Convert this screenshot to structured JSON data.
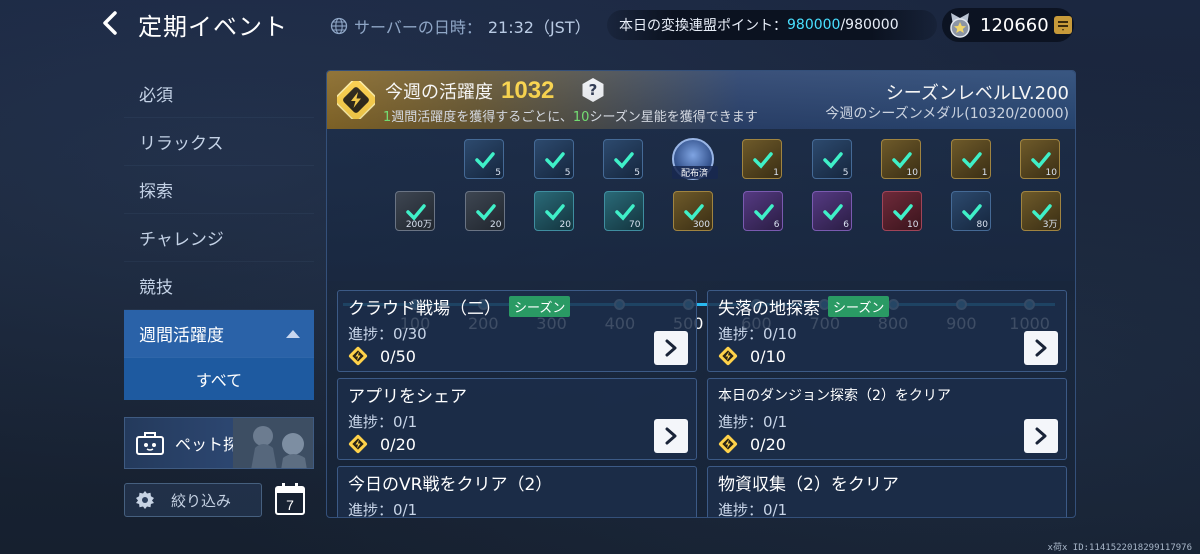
{
  "topbar": {
    "title": "定期イベント",
    "server_time_label": "サーバーの日時：",
    "server_time_value": "21:32（JST）",
    "points_label": "本日の変換連盟ポイント：",
    "points_current": "980000",
    "points_max": "/980000",
    "currency_amount": "120660"
  },
  "sidebar": {
    "items": [
      {
        "label": "必須"
      },
      {
        "label": "リラックス"
      },
      {
        "label": "探索"
      },
      {
        "label": "チャレンジ"
      },
      {
        "label": "競技"
      },
      {
        "label": "週間活躍度"
      }
    ],
    "sub_item": "すべて",
    "pet_label": "ペット探検",
    "filter_label": "絞り込み",
    "calendar_value": "7"
  },
  "header": {
    "title": "今週の活躍度",
    "score": "1032",
    "help": "?",
    "desc_num1": "1",
    "desc_part1": "週間活躍度を獲得するごとに、",
    "desc_num2": "10",
    "desc_part2": "シーズン星能を獲得できます",
    "season_level": "シーズンレベルLV.200",
    "season_medal": "今週のシーズンメダル(10320/20000)"
  },
  "rewards_top": [
    {
      "qty": "5",
      "style": "blue"
    },
    {
      "qty": "5",
      "style": "blue"
    },
    {
      "qty": "5",
      "style": "blue"
    },
    {
      "qty": "",
      "style": "claimed",
      "tag": "配布済"
    },
    {
      "qty": "1",
      "style": "gold"
    },
    {
      "qty": "5",
      "style": "blue"
    },
    {
      "qty": "10",
      "style": "gold"
    },
    {
      "qty": "1",
      "style": "gold"
    },
    {
      "qty": "10",
      "style": "gold"
    }
  ],
  "rewards_bottom": [
    {
      "qty": "200万",
      "style": "gray"
    },
    {
      "qty": "20",
      "style": "gray"
    },
    {
      "qty": "20",
      "style": "teal"
    },
    {
      "qty": "70",
      "style": "teal"
    },
    {
      "qty": "300",
      "style": "gold"
    },
    {
      "qty": "6",
      "style": "purple"
    },
    {
      "qty": "6",
      "style": "purple"
    },
    {
      "qty": "10",
      "style": "red"
    },
    {
      "qty": "80",
      "style": "blue"
    },
    {
      "qty": "3万",
      "style": "gold"
    }
  ],
  "milestones": [
    "100",
    "200",
    "300",
    "400",
    "500",
    "600",
    "700",
    "800",
    "900",
    "1000"
  ],
  "tasks": [
    {
      "title": "クラウド戦場（二）",
      "tag": "シーズン",
      "progress": "進捗：0/30",
      "reward": "0/50"
    },
    {
      "title": "失落の地探索",
      "tag": "シーズン",
      "progress": "進捗：0/10",
      "reward": "0/10"
    },
    {
      "title": "アプリをシェア",
      "tag": "",
      "progress": "進捗：0/1",
      "reward": "0/20"
    },
    {
      "title": "本日のダンジョン探索（2）をクリア",
      "tag": "",
      "progress": "進捗：0/1",
      "reward": "0/20"
    },
    {
      "title": "今日のVR戦をクリア（2）",
      "tag": "",
      "progress": "進捗：0/1",
      "reward": ""
    },
    {
      "title": "物資収集（2）をクリア",
      "tag": "",
      "progress": "進捗：0/1",
      "reward": ""
    }
  ],
  "uid": "x荷x ID:1141522018299117976",
  "colors": {
    "accent_blue": "#29b8f0",
    "gold": "#ffd84a",
    "green": "#7bf07a",
    "season_tag": "#2a9a64",
    "sidebar_active": "#2a62a8"
  }
}
